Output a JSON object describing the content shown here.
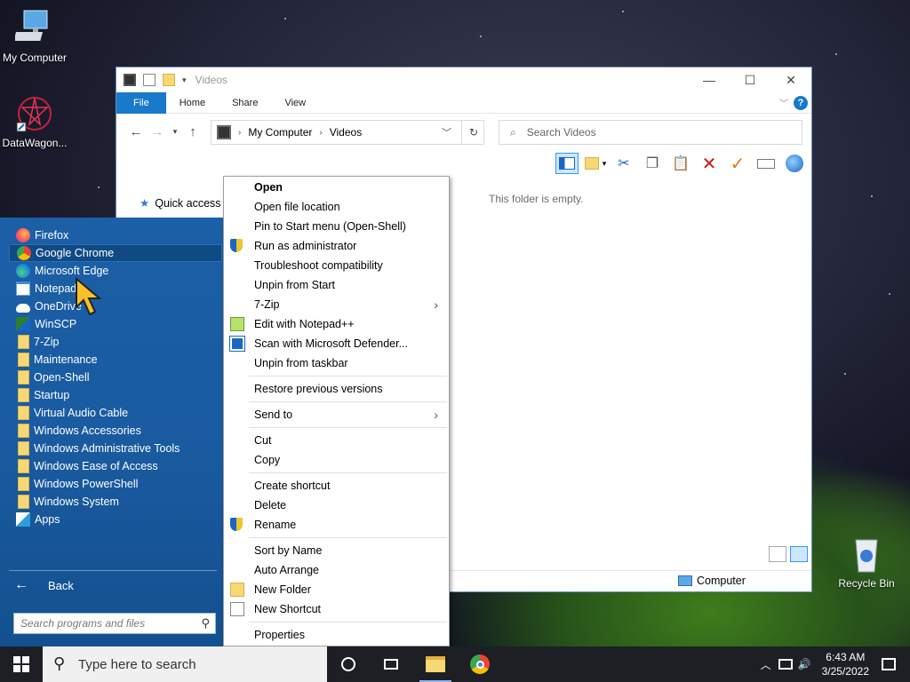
{
  "desktop": {
    "icons": [
      {
        "label": "My Computer",
        "icon": "computer-icon"
      },
      {
        "label": "DataWagon...",
        "icon": "datawagon-icon"
      },
      {
        "label": "Recycle Bin",
        "icon": "recycle-bin-icon"
      }
    ]
  },
  "explorer": {
    "title": "Videos",
    "ribbon_tabs": [
      "File",
      "Home",
      "Share",
      "View"
    ],
    "breadcrumb": [
      "My Computer",
      "Videos"
    ],
    "search_placeholder": "Search Videos",
    "nav_quick_access": "Quick access",
    "empty_message": "This folder is empty.",
    "status_location": "Computer"
  },
  "start_menu": {
    "items": [
      {
        "label": "Firefox",
        "icon": "firefox-icon"
      },
      {
        "label": "Google Chrome",
        "icon": "chrome-icon",
        "highlighted": true
      },
      {
        "label": "Microsoft Edge",
        "icon": "edge-icon"
      },
      {
        "label": "Notepad",
        "icon": "notepad-icon"
      },
      {
        "label": "OneDrive",
        "icon": "onedrive-icon"
      },
      {
        "label": "WinSCP",
        "icon": "winscp-icon"
      },
      {
        "label": "7-Zip",
        "icon": "folder-icon"
      },
      {
        "label": "Maintenance",
        "icon": "folder-icon"
      },
      {
        "label": "Open-Shell",
        "icon": "folder-icon"
      },
      {
        "label": "Startup",
        "icon": "folder-icon"
      },
      {
        "label": "Virtual Audio Cable",
        "icon": "folder-icon"
      },
      {
        "label": "Windows Accessories",
        "icon": "folder-icon"
      },
      {
        "label": "Windows Administrative Tools",
        "icon": "folder-icon"
      },
      {
        "label": "Windows Ease of Access",
        "icon": "folder-icon"
      },
      {
        "label": "Windows PowerShell",
        "icon": "folder-icon"
      },
      {
        "label": "Windows System",
        "icon": "folder-icon"
      },
      {
        "label": "Apps",
        "icon": "apps-icon"
      }
    ],
    "back_label": "Back",
    "search_placeholder": "Search programs and files"
  },
  "context_menu": {
    "groups": [
      [
        {
          "label": "Open",
          "bold": true
        },
        {
          "label": "Open file location"
        },
        {
          "label": "Pin to Start menu (Open-Shell)"
        },
        {
          "label": "Run as administrator",
          "icon": "uac-shield-icon"
        },
        {
          "label": "Troubleshoot compatibility"
        },
        {
          "label": "Unpin from Start"
        },
        {
          "label": "7-Zip",
          "submenu": true
        },
        {
          "label": "Edit with Notepad++",
          "icon": "notepadpp-icon"
        },
        {
          "label": "Scan with Microsoft Defender...",
          "icon": "defender-icon"
        },
        {
          "label": "Unpin from taskbar"
        }
      ],
      [
        {
          "label": "Restore previous versions"
        }
      ],
      [
        {
          "label": "Send to",
          "submenu": true
        }
      ],
      [
        {
          "label": "Cut"
        },
        {
          "label": "Copy"
        }
      ],
      [
        {
          "label": "Create shortcut"
        },
        {
          "label": "Delete"
        },
        {
          "label": "Rename",
          "icon": "uac-shield-icon"
        }
      ],
      [
        {
          "label": "Sort by Name"
        },
        {
          "label": "Auto Arrange"
        },
        {
          "label": "New Folder",
          "icon": "folder-icon"
        },
        {
          "label": "New Shortcut",
          "icon": "shortcut-icon"
        }
      ],
      [
        {
          "label": "Properties"
        }
      ]
    ]
  },
  "taskbar": {
    "search_placeholder": "Type here to search",
    "time": "6:43 AM",
    "date": "3/25/2022"
  },
  "colors": {
    "start_menu_blue": "#1a5ba1",
    "ribbon_file_blue": "#1979ca",
    "taskbar": "#1d1f24"
  }
}
